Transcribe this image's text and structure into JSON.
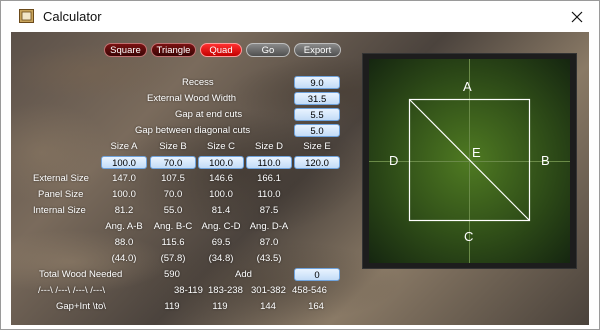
{
  "window": {
    "title": "Calculator",
    "close_glyph": "✕"
  },
  "shape_buttons": {
    "square": "Square",
    "triangle": "Triangle",
    "quad": "Quad",
    "go": "Go",
    "export": "Export"
  },
  "params": [
    {
      "label": "Recess",
      "value": "9.0"
    },
    {
      "label": "External Wood Width",
      "value": "31.5"
    },
    {
      "label": "Gap at end cuts",
      "value": "5.5"
    },
    {
      "label": "Gap between diagonal cuts",
      "value": "5.0"
    }
  ],
  "size_headers": [
    "Size A",
    "Size B",
    "Size C",
    "Size D",
    "Size E"
  ],
  "size_values": [
    "100.0",
    "70.0",
    "100.0",
    "110.0",
    "120.0"
  ],
  "rows": {
    "external": {
      "label": "External Size",
      "values": [
        "147.0",
        "107.5",
        "146.6",
        "166.1"
      ]
    },
    "panel": {
      "label": "Panel Size",
      "values": [
        "100.0",
        "70.0",
        "100.0",
        "110.0"
      ]
    },
    "internal": {
      "label": "Internal Size",
      "values": [
        "81.2",
        "55.0",
        "81.4",
        "87.5"
      ]
    }
  },
  "angle_headers": [
    "Ang. A-B",
    "Ang. B-C",
    "Ang. C-D",
    "Ang. D-A"
  ],
  "angle_values": [
    "88.0",
    "115.6",
    "69.5",
    "87.0"
  ],
  "angle_alt": [
    "(44.0)",
    "(57.8)",
    "(34.8)",
    "(43.5)"
  ],
  "total": {
    "label": "Total Wood Needed",
    "value": "590",
    "add_label": "Add",
    "add_value": "0"
  },
  "cuts": {
    "label": "/---\\ /---\\ /---\\ /---\\",
    "values": [
      "38-119",
      "183-238",
      "301-382",
      "458-546"
    ]
  },
  "gap": {
    "label": "Gap+Int \\to\\",
    "values": [
      "119",
      "119",
      "144",
      "164"
    ]
  },
  "preview": {
    "a": "A",
    "b": "B",
    "c": "C",
    "d": "D",
    "e": "E"
  },
  "icons": {
    "app": "frame-icon",
    "close": "close-icon"
  }
}
